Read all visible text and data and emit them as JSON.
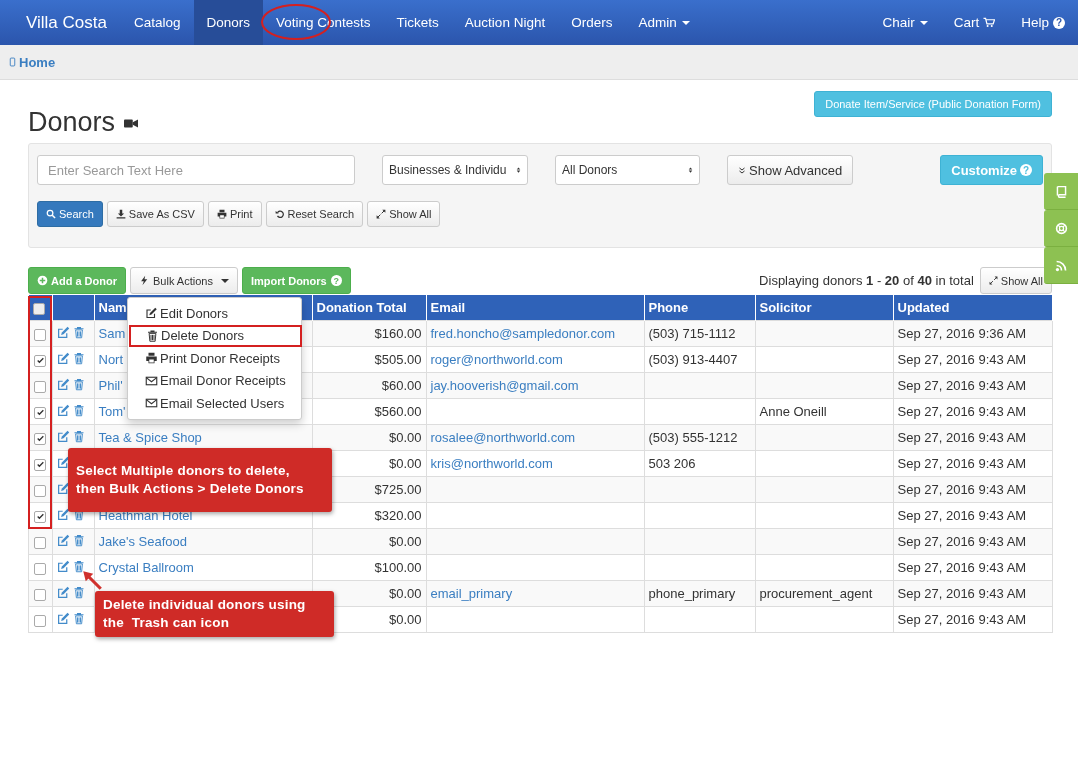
{
  "navbar": {
    "brand": "Villa Costa",
    "items": [
      {
        "label": "Catalog",
        "selected": false,
        "dropdown": false,
        "circled": false
      },
      {
        "label": "Donors",
        "selected": true,
        "dropdown": false,
        "circled": false
      },
      {
        "label": "Voting Contests",
        "selected": false,
        "dropdown": false,
        "circled": true
      },
      {
        "label": "Tickets",
        "selected": false,
        "dropdown": false,
        "circled": false
      },
      {
        "label": "Auction Night",
        "selected": false,
        "dropdown": false,
        "circled": false
      },
      {
        "label": "Orders",
        "selected": false,
        "dropdown": false,
        "circled": false
      },
      {
        "label": "Admin",
        "selected": false,
        "dropdown": true,
        "circled": false
      }
    ],
    "right_items": [
      {
        "label": "Chair"
      },
      {
        "label": "Cart"
      },
      {
        "label": "Help",
        "icon_text": "?"
      }
    ]
  },
  "breadcrumb": {
    "label": "Home"
  },
  "page": {
    "title": "Donors",
    "donate_button": "Donate Item/Service (Public Donation Form)"
  },
  "search_panel": {
    "search_placeholder": "Enter Search Text Here",
    "type_select": "Businesses & Individu",
    "filter_select": "All Donors",
    "advanced_button": "Show Advanced",
    "customize_button": "Customize",
    "customize_help": "?",
    "buttons": [
      {
        "label": "Search",
        "kind": "primary"
      },
      {
        "label": "Save As CSV",
        "kind": "default"
      },
      {
        "label": "Print",
        "kind": "default"
      },
      {
        "label": "Reset Search",
        "kind": "default"
      },
      {
        "label": "Show All",
        "kind": "default"
      }
    ]
  },
  "toolbar": {
    "buttons": [
      {
        "label": "Add a Donor",
        "kind": "success"
      },
      {
        "label": "Bulk Actions",
        "kind": "default"
      },
      {
        "label": "Import Donors",
        "kind": "success",
        "badge": "?"
      }
    ],
    "summary": "Displaying donors **1** - **20** of **40** in total",
    "show_all": "Show All"
  },
  "bulk_menu": {
    "items": [
      {
        "label": "Edit Donors",
        "highlighted": false
      },
      {
        "label": "Delete Donors",
        "highlighted": true
      },
      {
        "label": "Print Donor Receipts",
        "highlighted": false
      },
      {
        "label": "Email Donor Receipts",
        "highlighted": false
      },
      {
        "label": "Email Selected Users",
        "highlighted": false
      }
    ]
  },
  "table": {
    "select_all": {
      "checked": false
    },
    "checkbox_column_outlined": true,
    "columns": [
      "Nam",
      "Donation Total",
      "Email",
      "Phone",
      "Solicitor",
      "Updated"
    ],
    "rows": [
      {
        "checked": false,
        "name": "Sam",
        "donation_total": "$160.00",
        "email": "fred.honcho@sampledonor.com",
        "phone": "(503) 715-1112",
        "updated": "Sep 27, 2016 9:36 AM"
      },
      {
        "checked": true,
        "name": "Nort",
        "donation_total": "$505.00",
        "email": "roger@northworld.com",
        "phone": "(503) 913-4407",
        "updated": "Sep 27, 2016 9:43 AM"
      },
      {
        "checked": false,
        "name": "Phil'",
        "donation_total": "$60.00",
        "email": "jay.hooverish@gmail.com",
        "updated": "Sep 27, 2016 9:43 AM"
      },
      {
        "checked": true,
        "name": "Tom'",
        "donation_total": "$560.00",
        "solicitor": "Anne Oneill",
        "updated": "Sep 27, 2016 9:43 AM"
      },
      {
        "checked": true,
        "name": "Tea & Spice Shop",
        "donation_total": "$0.00",
        "email": "rosalee@northworld.com",
        "phone": "(503) 555-1212",
        "updated": "Sep 27, 2016 9:43 AM"
      },
      {
        "checked": true,
        "donation_total": "$0.00",
        "email": "kris@northworld.com",
        "phone": "503 206",
        "updated": "Sep 27, 2016 9:43 AM"
      },
      {
        "checked": false,
        "donation_total": "$725.00",
        "updated": "Sep 27, 2016 9:43 AM"
      },
      {
        "checked": true,
        "name": "Heathman Hotel",
        "donation_total": "$320.00",
        "updated": "Sep 27, 2016 9:43 AM"
      },
      {
        "checked": false,
        "name": "Jake's Seafood",
        "donation_total": "$0.00",
        "updated": "Sep 27, 2016 9:43 AM"
      },
      {
        "checked": false,
        "name": "Crystal Ballroom",
        "donation_total": "$100.00",
        "updated": "Sep 27, 2016 9:43 AM"
      },
      {
        "checked": false,
        "donation_total": "$0.00",
        "email": "email_primary",
        "phone": "phone_primary",
        "solicitor": "procurement_agent",
        "updated": "Sep 27, 2016 9:43 AM"
      },
      {
        "checked": false,
        "donation_total": "$0.00",
        "updated": "Sep 27, 2016 9:43 AM"
      }
    ]
  },
  "callouts": [
    {
      "text": "Select Multiple donors to delete,\nthen Bulk Actions > Delete Donors",
      "pointer": false
    },
    {
      "text": "Delete individual donors using\nthe  Trash can icon",
      "pointer": true
    }
  ]
}
